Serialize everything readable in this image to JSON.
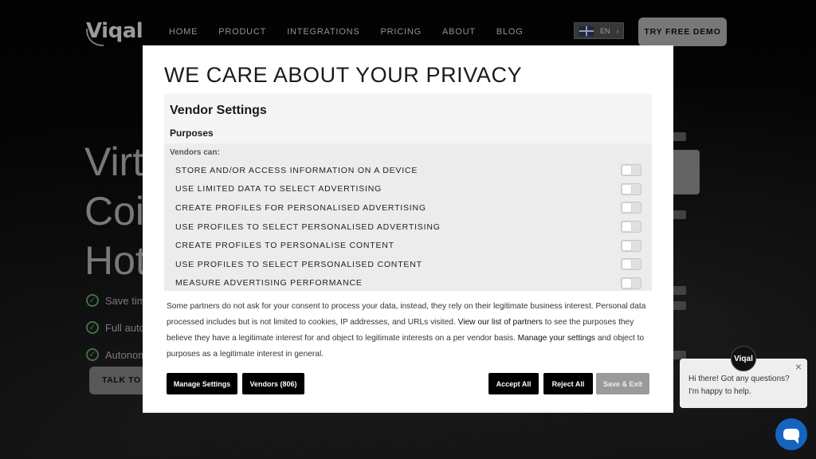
{
  "site": {
    "logo": "Viqal",
    "nav": [
      "HOME",
      "PRODUCT",
      "INTEGRATIONS",
      "PRICING",
      "ABOUT",
      "BLOG"
    ],
    "language": "EN",
    "language_chevron": "›",
    "demo_button": "TRY FREE DEMO",
    "hero_lines": [
      "Virt",
      "Coi",
      "Hot"
    ],
    "hero_bullets": [
      "Save tim",
      "Full auto",
      "Autonom"
    ],
    "talk_button": "TALK TO S"
  },
  "modal": {
    "title": "WE CARE ABOUT YOUR PRIVACY",
    "vendor_settings": "Vendor Settings",
    "purposes": "Purposes",
    "vendors_can": "Vendors can:",
    "purpose_items": [
      "STORE AND/OR ACCESS INFORMATION ON A DEVICE",
      "USE LIMITED DATA TO SELECT ADVERTISING",
      "CREATE PROFILES FOR PERSONALISED ADVERTISING",
      "USE PROFILES TO SELECT PERSONALISED ADVERTISING",
      "CREATE PROFILES TO PERSONALISE CONTENT",
      "USE PROFILES TO SELECT PERSONALISED CONTENT",
      "MEASURE ADVERTISING PERFORMANCE"
    ],
    "info_part1": "Some partners do not ask for your consent to process your data, instead, they rely on their legitimate business interest. Personal data processed includes but is not limited to cookies, IP addresses, and URLs visited.",
    "info_link1": "View our list of partners",
    "info_part2": "to see the purposes they believe they have a legitimate interest for and object to legitimate interests on a per vendor basis.",
    "info_link2": "Manage your settings",
    "info_part3": "and object to purposes as a legitimate interest in general.",
    "buttons": {
      "manage": "Manage Settings",
      "vendors": "Vendors (806)",
      "accept": "Accept All",
      "reject": "Reject All",
      "save": "Save & Exit"
    }
  },
  "chat": {
    "avatar": "Viqal",
    "message": "Hi there! Got any questions? I'm happy to help.",
    "close": "×"
  }
}
